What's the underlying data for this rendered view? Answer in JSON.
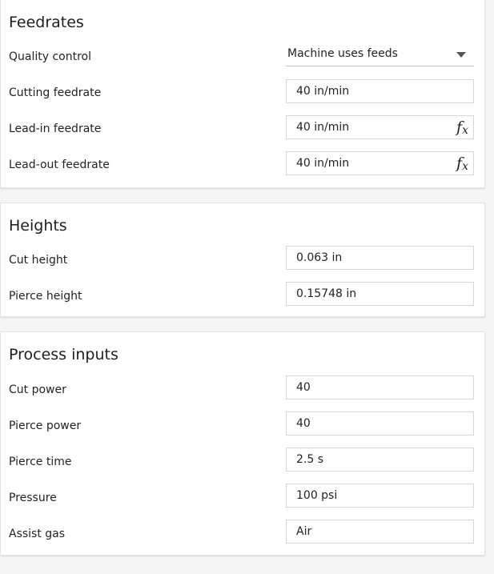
{
  "feedrates": {
    "title": "Feedrates",
    "quality_control": {
      "label": "Quality control",
      "value": "Machine uses feeds",
      "icon": "chevron-down-icon"
    },
    "cutting_feedrate": {
      "label": "Cutting feedrate",
      "value": "40 in/min"
    },
    "lead_in_feedrate": {
      "label": "Lead-in feedrate",
      "value": "40 in/min",
      "fx": "f",
      "fx_sub": "x"
    },
    "lead_out_feedrate": {
      "label": "Lead-out feedrate",
      "value": "40 in/min",
      "fx": "f",
      "fx_sub": "x"
    }
  },
  "heights": {
    "title": "Heights",
    "cut_height": {
      "label": "Cut height",
      "value": "0.063 in"
    },
    "pierce_height": {
      "label": "Pierce height",
      "value": "0.15748 in"
    }
  },
  "process_inputs": {
    "title": "Process inputs",
    "cut_power": {
      "label": "Cut power",
      "value": "40"
    },
    "pierce_power": {
      "label": "Pierce power",
      "value": "40"
    },
    "pierce_time": {
      "label": "Pierce time",
      "value": "2.5 s"
    },
    "pressure": {
      "label": "Pressure",
      "value": "100 psi"
    },
    "assist_gas": {
      "label": "Assist gas",
      "value": "Air"
    }
  }
}
